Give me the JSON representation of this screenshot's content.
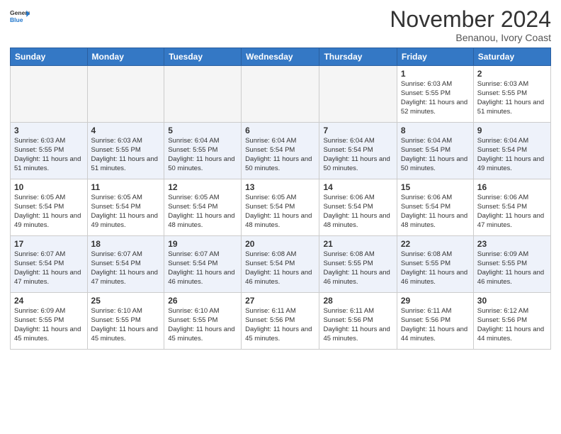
{
  "header": {
    "logo_general": "General",
    "logo_blue": "Blue",
    "month_title": "November 2024",
    "location": "Benanou, Ivory Coast"
  },
  "weekdays": [
    "Sunday",
    "Monday",
    "Tuesday",
    "Wednesday",
    "Thursday",
    "Friday",
    "Saturday"
  ],
  "weeks": [
    [
      {
        "day": "",
        "info": ""
      },
      {
        "day": "",
        "info": ""
      },
      {
        "day": "",
        "info": ""
      },
      {
        "day": "",
        "info": ""
      },
      {
        "day": "",
        "info": ""
      },
      {
        "day": "1",
        "info": "Sunrise: 6:03 AM\nSunset: 5:55 PM\nDaylight: 11 hours\nand 52 minutes."
      },
      {
        "day": "2",
        "info": "Sunrise: 6:03 AM\nSunset: 5:55 PM\nDaylight: 11 hours\nand 51 minutes."
      }
    ],
    [
      {
        "day": "3",
        "info": "Sunrise: 6:03 AM\nSunset: 5:55 PM\nDaylight: 11 hours\nand 51 minutes."
      },
      {
        "day": "4",
        "info": "Sunrise: 6:03 AM\nSunset: 5:55 PM\nDaylight: 11 hours\nand 51 minutes."
      },
      {
        "day": "5",
        "info": "Sunrise: 6:04 AM\nSunset: 5:55 PM\nDaylight: 11 hours\nand 50 minutes."
      },
      {
        "day": "6",
        "info": "Sunrise: 6:04 AM\nSunset: 5:54 PM\nDaylight: 11 hours\nand 50 minutes."
      },
      {
        "day": "7",
        "info": "Sunrise: 6:04 AM\nSunset: 5:54 PM\nDaylight: 11 hours\nand 50 minutes."
      },
      {
        "day": "8",
        "info": "Sunrise: 6:04 AM\nSunset: 5:54 PM\nDaylight: 11 hours\nand 50 minutes."
      },
      {
        "day": "9",
        "info": "Sunrise: 6:04 AM\nSunset: 5:54 PM\nDaylight: 11 hours\nand 49 minutes."
      }
    ],
    [
      {
        "day": "10",
        "info": "Sunrise: 6:05 AM\nSunset: 5:54 PM\nDaylight: 11 hours\nand 49 minutes."
      },
      {
        "day": "11",
        "info": "Sunrise: 6:05 AM\nSunset: 5:54 PM\nDaylight: 11 hours\nand 49 minutes."
      },
      {
        "day": "12",
        "info": "Sunrise: 6:05 AM\nSunset: 5:54 PM\nDaylight: 11 hours\nand 48 minutes."
      },
      {
        "day": "13",
        "info": "Sunrise: 6:05 AM\nSunset: 5:54 PM\nDaylight: 11 hours\nand 48 minutes."
      },
      {
        "day": "14",
        "info": "Sunrise: 6:06 AM\nSunset: 5:54 PM\nDaylight: 11 hours\nand 48 minutes."
      },
      {
        "day": "15",
        "info": "Sunrise: 6:06 AM\nSunset: 5:54 PM\nDaylight: 11 hours\nand 48 minutes."
      },
      {
        "day": "16",
        "info": "Sunrise: 6:06 AM\nSunset: 5:54 PM\nDaylight: 11 hours\nand 47 minutes."
      }
    ],
    [
      {
        "day": "17",
        "info": "Sunrise: 6:07 AM\nSunset: 5:54 PM\nDaylight: 11 hours\nand 47 minutes."
      },
      {
        "day": "18",
        "info": "Sunrise: 6:07 AM\nSunset: 5:54 PM\nDaylight: 11 hours\nand 47 minutes."
      },
      {
        "day": "19",
        "info": "Sunrise: 6:07 AM\nSunset: 5:54 PM\nDaylight: 11 hours\nand 46 minutes."
      },
      {
        "day": "20",
        "info": "Sunrise: 6:08 AM\nSunset: 5:54 PM\nDaylight: 11 hours\nand 46 minutes."
      },
      {
        "day": "21",
        "info": "Sunrise: 6:08 AM\nSunset: 5:55 PM\nDaylight: 11 hours\nand 46 minutes."
      },
      {
        "day": "22",
        "info": "Sunrise: 6:08 AM\nSunset: 5:55 PM\nDaylight: 11 hours\nand 46 minutes."
      },
      {
        "day": "23",
        "info": "Sunrise: 6:09 AM\nSunset: 5:55 PM\nDaylight: 11 hours\nand 46 minutes."
      }
    ],
    [
      {
        "day": "24",
        "info": "Sunrise: 6:09 AM\nSunset: 5:55 PM\nDaylight: 11 hours\nand 45 minutes."
      },
      {
        "day": "25",
        "info": "Sunrise: 6:10 AM\nSunset: 5:55 PM\nDaylight: 11 hours\nand 45 minutes."
      },
      {
        "day": "26",
        "info": "Sunrise: 6:10 AM\nSunset: 5:55 PM\nDaylight: 11 hours\nand 45 minutes."
      },
      {
        "day": "27",
        "info": "Sunrise: 6:11 AM\nSunset: 5:56 PM\nDaylight: 11 hours\nand 45 minutes."
      },
      {
        "day": "28",
        "info": "Sunrise: 6:11 AM\nSunset: 5:56 PM\nDaylight: 11 hours\nand 45 minutes."
      },
      {
        "day": "29",
        "info": "Sunrise: 6:11 AM\nSunset: 5:56 PM\nDaylight: 11 hours\nand 44 minutes."
      },
      {
        "day": "30",
        "info": "Sunrise: 6:12 AM\nSunset: 5:56 PM\nDaylight: 11 hours\nand 44 minutes."
      }
    ]
  ]
}
